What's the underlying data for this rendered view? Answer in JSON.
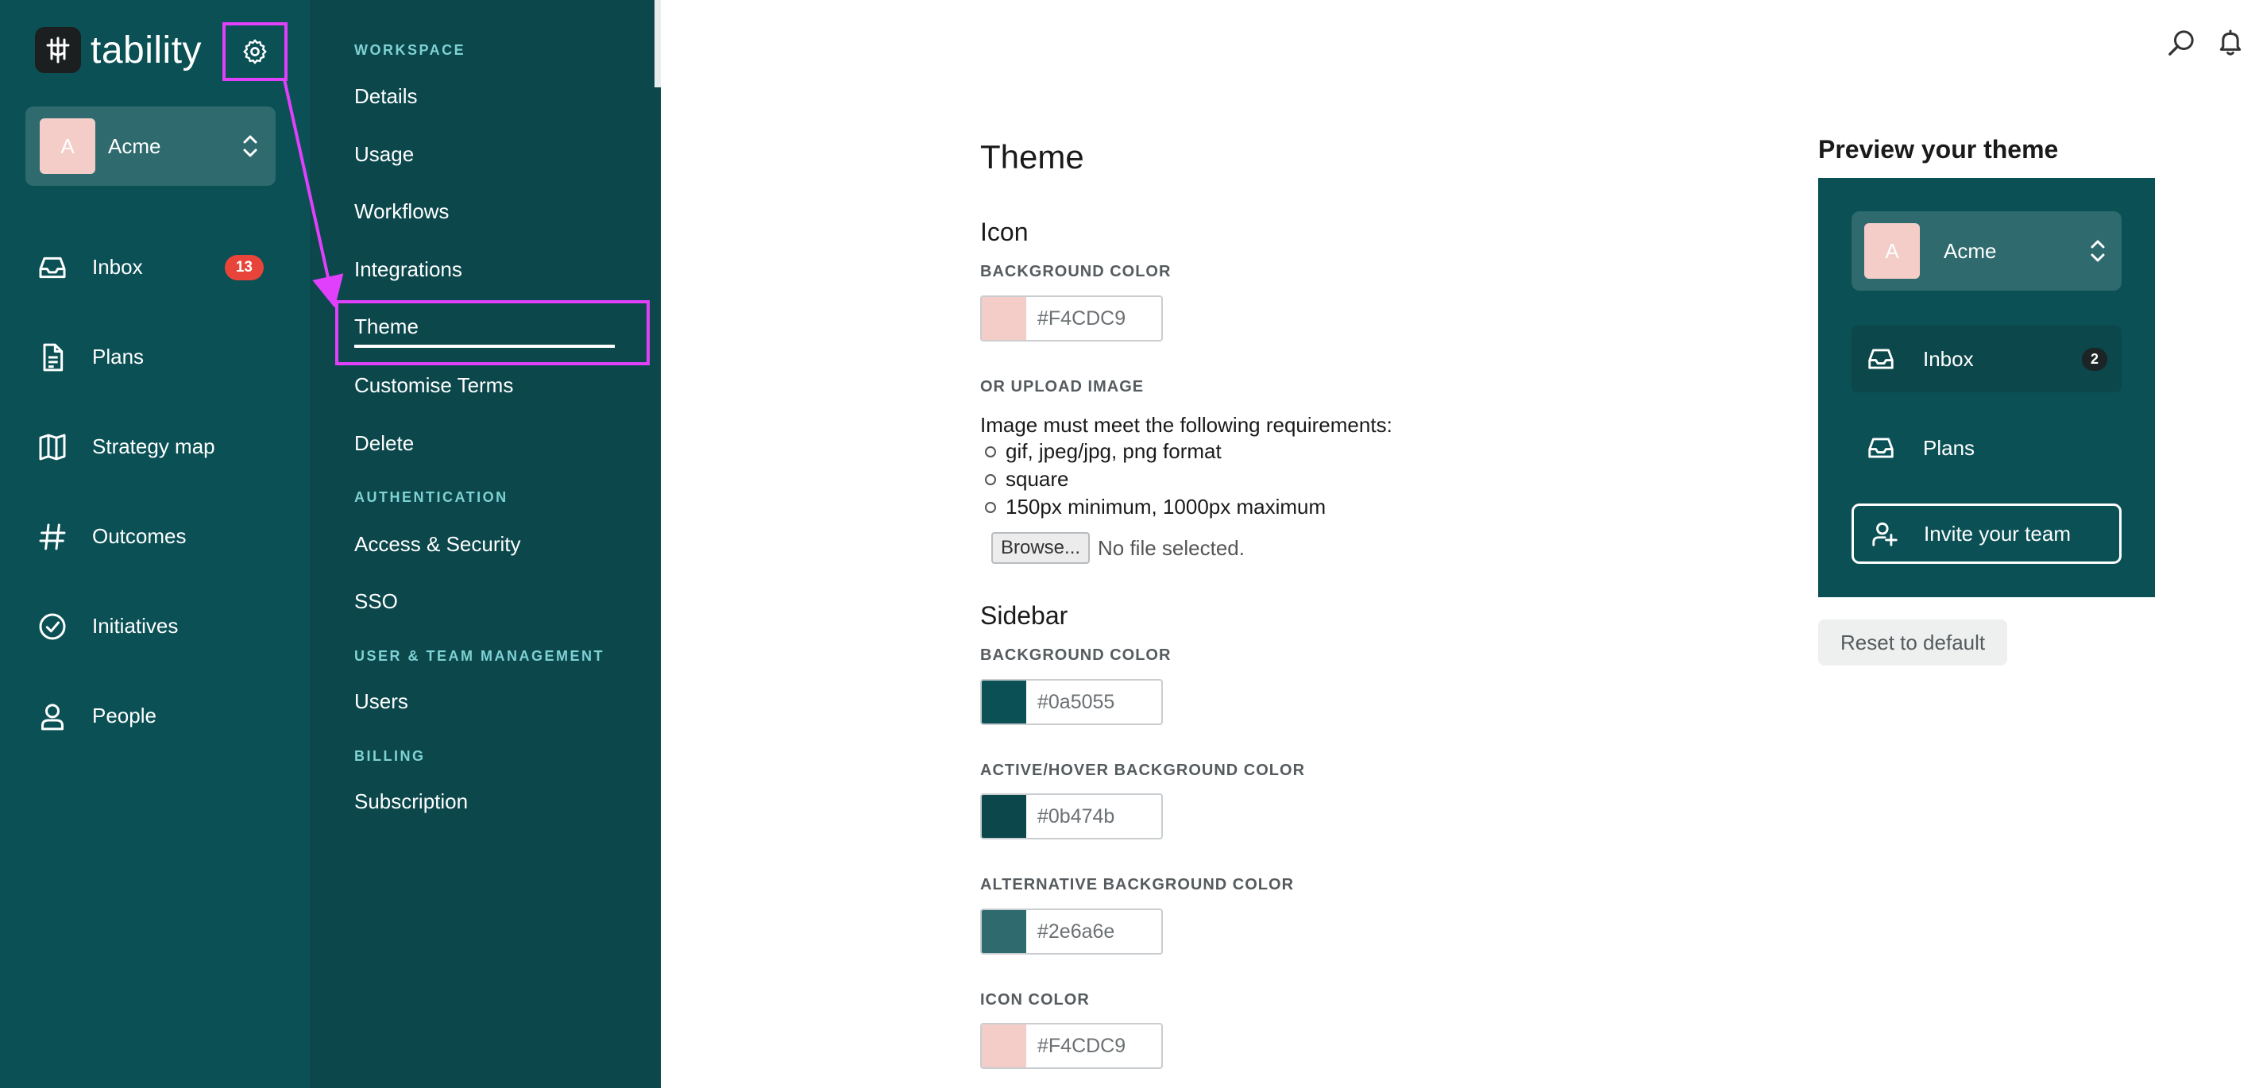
{
  "app": {
    "name": "tability",
    "workspace": {
      "initial": "A",
      "name": "Acme"
    }
  },
  "sidebar": {
    "items": [
      {
        "label": "Inbox",
        "icon": "inbox-icon",
        "badge": "13"
      },
      {
        "label": "Plans",
        "icon": "document-icon"
      },
      {
        "label": "Strategy map",
        "icon": "map-icon"
      },
      {
        "label": "Outcomes",
        "icon": "hash-icon"
      },
      {
        "label": "Initiatives",
        "icon": "check-circle-icon"
      },
      {
        "label": "People",
        "icon": "person-icon"
      }
    ]
  },
  "settings_nav": {
    "workspace_heading": "WORKSPACE",
    "workspace_items": [
      "Details",
      "Usage",
      "Workflows",
      "Integrations",
      "Theme",
      "Customise Terms",
      "Delete"
    ],
    "auth_heading": "AUTHENTICATION",
    "auth_items": [
      "Access & Security",
      "SSO"
    ],
    "users_heading": "USER & TEAM MANAGEMENT",
    "users_items": [
      "Users"
    ],
    "billing_heading": "BILLING",
    "billing_items": [
      "Subscription"
    ],
    "active": "Theme"
  },
  "content": {
    "title": "Theme",
    "icon_section": {
      "title": "Icon",
      "bg_label": "BACKGROUND COLOR",
      "bg_value": "#F4CDC9",
      "upload_label": "OR UPLOAD IMAGE",
      "requirements_intro": "Image must meet the following requirements:",
      "requirements": [
        "gif, jpeg/jpg, png format",
        "square",
        "150px minimum, 1000px maximum"
      ],
      "browse_label": "Browse...",
      "no_file": "No file selected."
    },
    "sidebar_section": {
      "title": "Sidebar",
      "fields": [
        {
          "label": "BACKGROUND COLOR",
          "value": "#0a5055"
        },
        {
          "label": "ACTIVE/HOVER BACKGROUND COLOR",
          "value": "#0b474b"
        },
        {
          "label": "ALTERNATIVE BACKGROUND COLOR",
          "value": "#2e6a6e"
        },
        {
          "label": "ICON COLOR",
          "value": "#F4CDC9"
        }
      ]
    }
  },
  "preview": {
    "title": "Preview your theme",
    "workspace_initial": "A",
    "workspace_name": "Acme",
    "inbox_label": "Inbox",
    "inbox_badge": "2",
    "plans_label": "Plans",
    "invite_label": "Invite your team",
    "reset_label": "Reset to default"
  },
  "colors": {
    "sidebar_bg": "#0a5055",
    "sidebar_active": "#0b474b",
    "sidebar_alt": "#2e6a6e",
    "icon_color": "#F4CDC9",
    "highlight": "#e040fb",
    "badge_red": "#e8443a"
  }
}
